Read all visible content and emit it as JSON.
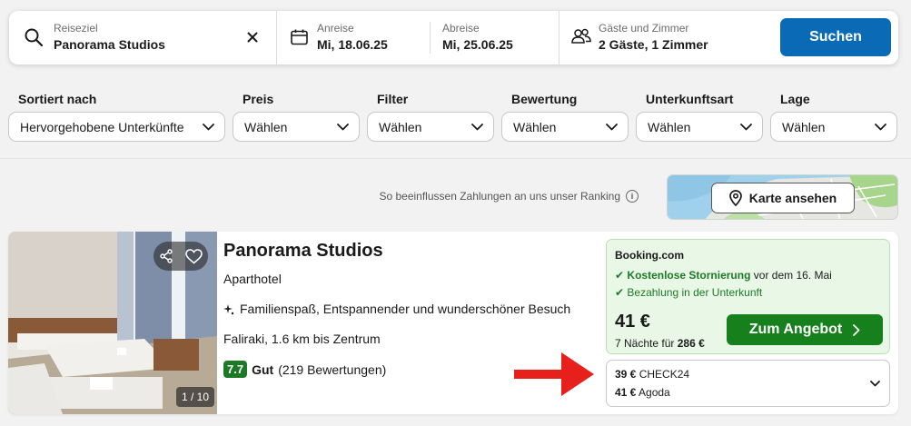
{
  "search": {
    "destination_label": "Reiseziel",
    "destination_value": "Panorama Studios",
    "checkin_label": "Anreise",
    "checkin_value": "Mi, 18.06.25",
    "checkout_label": "Abreise",
    "checkout_value": "Mi, 25.06.25",
    "guests_label": "Gäste und Zimmer",
    "guests_value": "2 Gäste, 1 Zimmer",
    "search_button": "Suchen"
  },
  "filters": [
    {
      "label": "Sortiert nach",
      "value": "Hervorgehobene Unterkünfte"
    },
    {
      "label": "Preis",
      "value": "Wählen"
    },
    {
      "label": "Filter",
      "value": "Wählen"
    },
    {
      "label": "Bewertung",
      "value": "Wählen"
    },
    {
      "label": "Unterkunftsart",
      "value": "Wählen"
    },
    {
      "label": "Lage",
      "value": "Wählen"
    }
  ],
  "ranking_note": "So beeinflussen Zahlungen an uns unser Ranking",
  "map_button": "Karte ansehen",
  "hotel": {
    "name": "Panorama Studios",
    "type": "Aparthotel",
    "highlight": "Familienspaß, Entspannender und wunderschöner Besuch",
    "location": "Faliraki, 1.6 km bis Zentrum",
    "rating_score": "7.7",
    "rating_word": "Gut",
    "rating_count": "(219 Bewertungen)",
    "photo_counter": "1 / 10"
  },
  "offer": {
    "provider": "Booking.com",
    "cancellation_bold": "Kostenlose Stornierung",
    "cancellation_rest": "vor dem 16. Mai",
    "payment": "Bezahlung in der Unterkunft",
    "price": "41 €",
    "nights_prefix": "7 Nächte für",
    "total": "286 €",
    "button": "Zum Angebot"
  },
  "other_offers": [
    {
      "price": "39 €",
      "provider": "CHECK24"
    },
    {
      "price": "41 €",
      "provider": "Agoda"
    }
  ],
  "colors": {
    "search_button": "#0a6ab6",
    "offer_button": "#15801c",
    "offer_bg": "#e9f8e6",
    "rating_badge": "#1c7a26",
    "arrow": "#e8201c"
  }
}
